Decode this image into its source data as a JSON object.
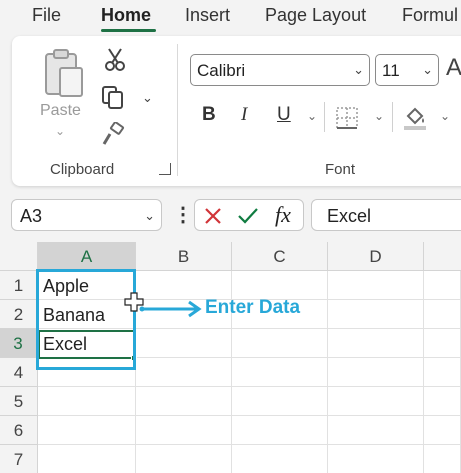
{
  "menu": {
    "tabs": [
      "File",
      "Home",
      "Insert",
      "Page Layout",
      "Formul"
    ],
    "active_tab": "Home"
  },
  "ribbon": {
    "clipboard": {
      "paste_label": "Paste",
      "group_label": "Clipboard",
      "icons": [
        "clipboard-icon",
        "scissors-icon",
        "copy-icon",
        "format-painter-icon"
      ]
    },
    "font": {
      "font_name": "Calibri",
      "font_size": "11",
      "bold_label": "B",
      "italic_label": "I",
      "underline_label": "U",
      "grow_label": "A",
      "group_label": "Font",
      "icons": [
        "borders-icon",
        "fill-color-icon"
      ]
    }
  },
  "formula_bar": {
    "name_box": "A3",
    "fx_label": "fx",
    "formula_value": "Excel",
    "icons": [
      "cancel-icon",
      "confirm-icon",
      "more-options-icon"
    ]
  },
  "grid": {
    "columns": [
      "A",
      "B",
      "C",
      "D"
    ],
    "rows": [
      "1",
      "2",
      "3",
      "4",
      "5",
      "6",
      "7"
    ],
    "cells": {
      "A1": "Apple",
      "A2": "Banana",
      "A3": "Excel"
    },
    "active_cell": "A3"
  },
  "annotation": {
    "text": "Enter Data",
    "color": "#28a8d8"
  },
  "colors": {
    "accent": "#1e7145",
    "annotation": "#28a8d8",
    "cancel": "#d13438",
    "confirm": "#107c41"
  }
}
